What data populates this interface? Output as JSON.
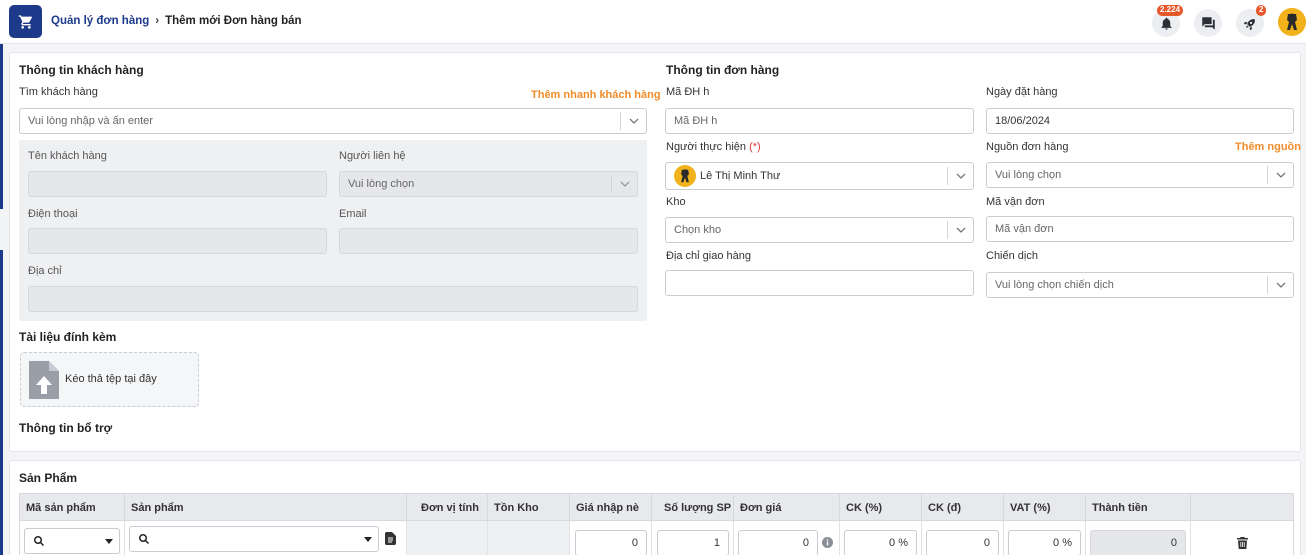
{
  "breadcrumb": {
    "parent": "Quản lý đơn hàng",
    "current": "Thêm mới Đơn hàng bán"
  },
  "header": {
    "notifications_count": "2.224",
    "rocket_count": "2"
  },
  "customer": {
    "section_title": "Thông tin khách hàng",
    "search_label": "Tìm khách hàng",
    "quick_add_link": "Thêm nhanh khách hàng",
    "search_placeholder": "Vui lòng nhập và ấn enter",
    "name_label": "Tên khách hàng",
    "contact_label": "Người liên hệ",
    "contact_placeholder": "Vui lòng chọn",
    "phone_label": "Điện thoại",
    "email_label": "Email",
    "address_label": "Địa chỉ"
  },
  "attachments": {
    "section_title": "Tài liệu đính kèm",
    "drop_text": "Kéo thả tệp tại đây"
  },
  "support": {
    "section_title": "Thông tin bổ trợ"
  },
  "order": {
    "section_title": "Thông tin đơn hàng",
    "code_label": "Mã ĐH h",
    "code_placeholder": "Mã ĐH h",
    "date_label": "Ngày đặt hàng",
    "date_value": "18/06/2024",
    "assignee_label": "Người thực hiện",
    "assignee_required": "(*)",
    "assignee_value": "Lê Thị Minh Thư",
    "source_label": "Nguồn đơn hàng",
    "add_source_link": "Thêm nguồn",
    "source_placeholder": "Vui lòng chọn",
    "warehouse_label": "Kho",
    "warehouse_placeholder": "Chọn kho",
    "tracking_label": "Mã vận đơn",
    "tracking_placeholder": "Mã vận đơn",
    "shipping_address_label": "Địa chỉ giao hàng",
    "campaign_label": "Chiến dịch",
    "campaign_placeholder": "Vui lòng chọn chiến dịch"
  },
  "products": {
    "section_title": "Sản Phẩm",
    "columns": [
      "Mã sản phẩm",
      "Sản phẩm",
      "Đơn vị tính",
      "Tồn Kho",
      "Giá nhập nè",
      "Số lượng SP",
      "Đơn giá",
      "CK (%)",
      "CK (đ)",
      "VAT (%)",
      "Thành tiền"
    ],
    "row": {
      "import_price": "0",
      "quantity": "1",
      "unit_price": "0",
      "discount_pct": "0 %",
      "discount_amount": "0",
      "vat_pct": "0 %",
      "total": "0"
    }
  },
  "colors": {
    "primary": "#1d3a8a",
    "accent": "#f08c2a",
    "required": "#e53935",
    "badge": "#e8572a"
  }
}
